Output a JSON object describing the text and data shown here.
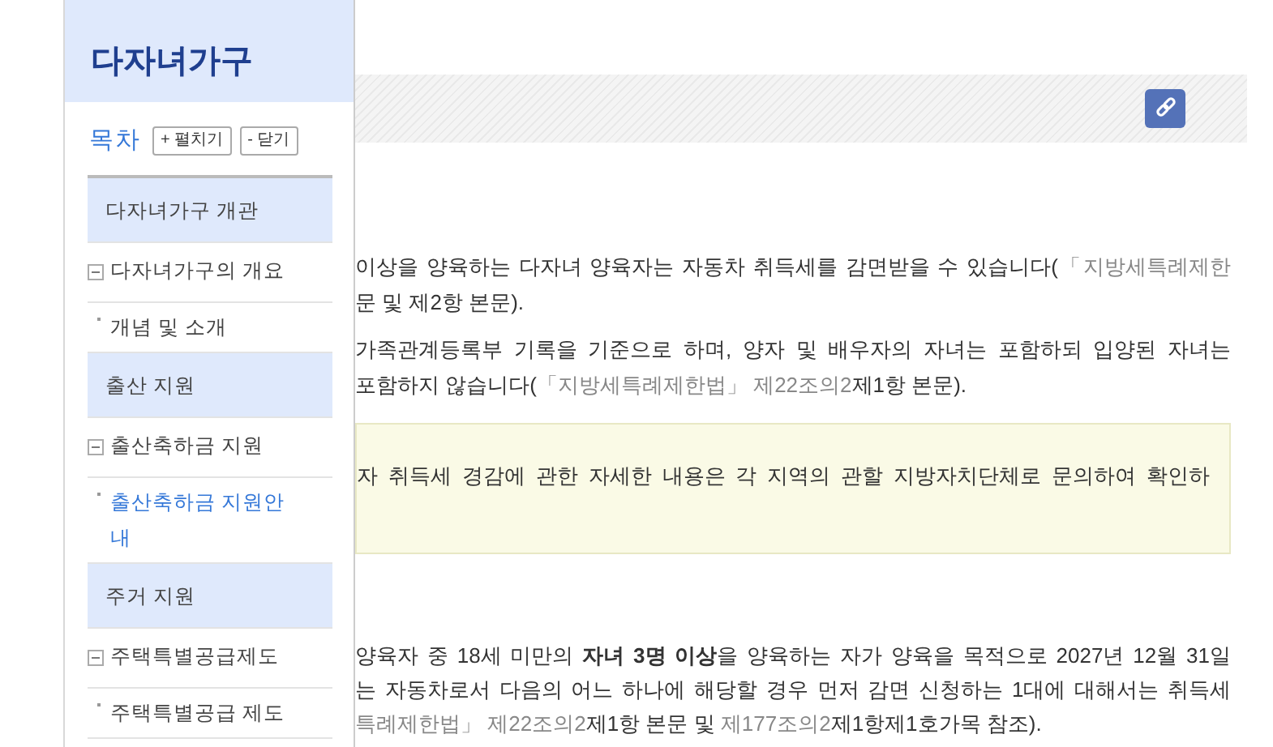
{
  "sidebar": {
    "title": "다자녀가구",
    "toc_label": "목차",
    "buttons": [
      {
        "label": "+ 펼치기"
      },
      {
        "label": "- 닫기"
      }
    ],
    "sections": [
      {
        "title": "다자녀가구 개관",
        "children": [
          {
            "title": "다자녀가구의 개요",
            "expanded": true,
            "children": [
              {
                "title": "개념 및 소개",
                "selected": false
              }
            ]
          }
        ]
      },
      {
        "title": "출산 지원",
        "children": [
          {
            "title": "출산축하금 지원",
            "expanded": true,
            "children": [
              {
                "title": "출산축하금 지원안내",
                "selected": true
              }
            ]
          }
        ]
      },
      {
        "title": "주거 지원",
        "children": [
          {
            "title": "주택특별공급제도",
            "expanded": true,
            "children": [
              {
                "title": "주택특별공급 제도",
                "selected": false
              }
            ]
          }
        ]
      }
    ]
  },
  "content": {
    "blocks": [
      {
        "kind": "paragraph",
        "lines": [
          [
            {
              "kind": "text",
              "text": "이상을 양육하는 다자녀 양육자는 자동차 취득세를 감면받을 수 있습니다("
            },
            {
              "kind": "ref",
              "text": "「지방세특례제한"
            }
          ],
          [
            {
              "kind": "text",
              "text": "문 및 제2항 본문)."
            }
          ]
        ]
      },
      {
        "kind": "paragraph",
        "lines": [
          [
            {
              "kind": "text",
              "text": "가족관계등록부 기록을 기준으로 하며, 양자 및 배우자의 자녀는 포함하되 입양된 자녀는"
            }
          ],
          [
            {
              "kind": "text",
              "text": "포함하지 않습니다("
            },
            {
              "kind": "ref",
              "text": "「지방세특례제한법」 제22조의2"
            },
            {
              "kind": "text",
              "text": "제1항 본문)."
            }
          ]
        ]
      },
      {
        "kind": "note",
        "lines": [
          [
            {
              "kind": "text",
              "text": "자 취득세 경감에 관한 자세한 내용은 각 지역의 관할 지방자치단체로 문의하여 확인하"
            }
          ]
        ]
      },
      {
        "kind": "paragraph",
        "lines": [
          [
            {
              "kind": "text",
              "text": "양육자 중 18세 미만의 **자녀 3명 이상**을 양육하는 자가 양육을 목적으로 2027년 12월 31일"
            }
          ],
          [
            {
              "kind": "text",
              "text": "는 자동차로서 다음의 어느 하나에 해당할 경우 먼저 감면 신청하는 1대에 대해서는 취득세"
            }
          ],
          [
            {
              "kind": "ref",
              "text": "특례제한법」 제22조의2"
            },
            {
              "kind": "text",
              "text": "제1항 본문 및 "
            },
            {
              "kind": "ref",
              "text": "제177조의2"
            },
            {
              "kind": "text",
              "text": "제1항제1호가목 참조)."
            }
          ]
        ]
      }
    ]
  }
}
